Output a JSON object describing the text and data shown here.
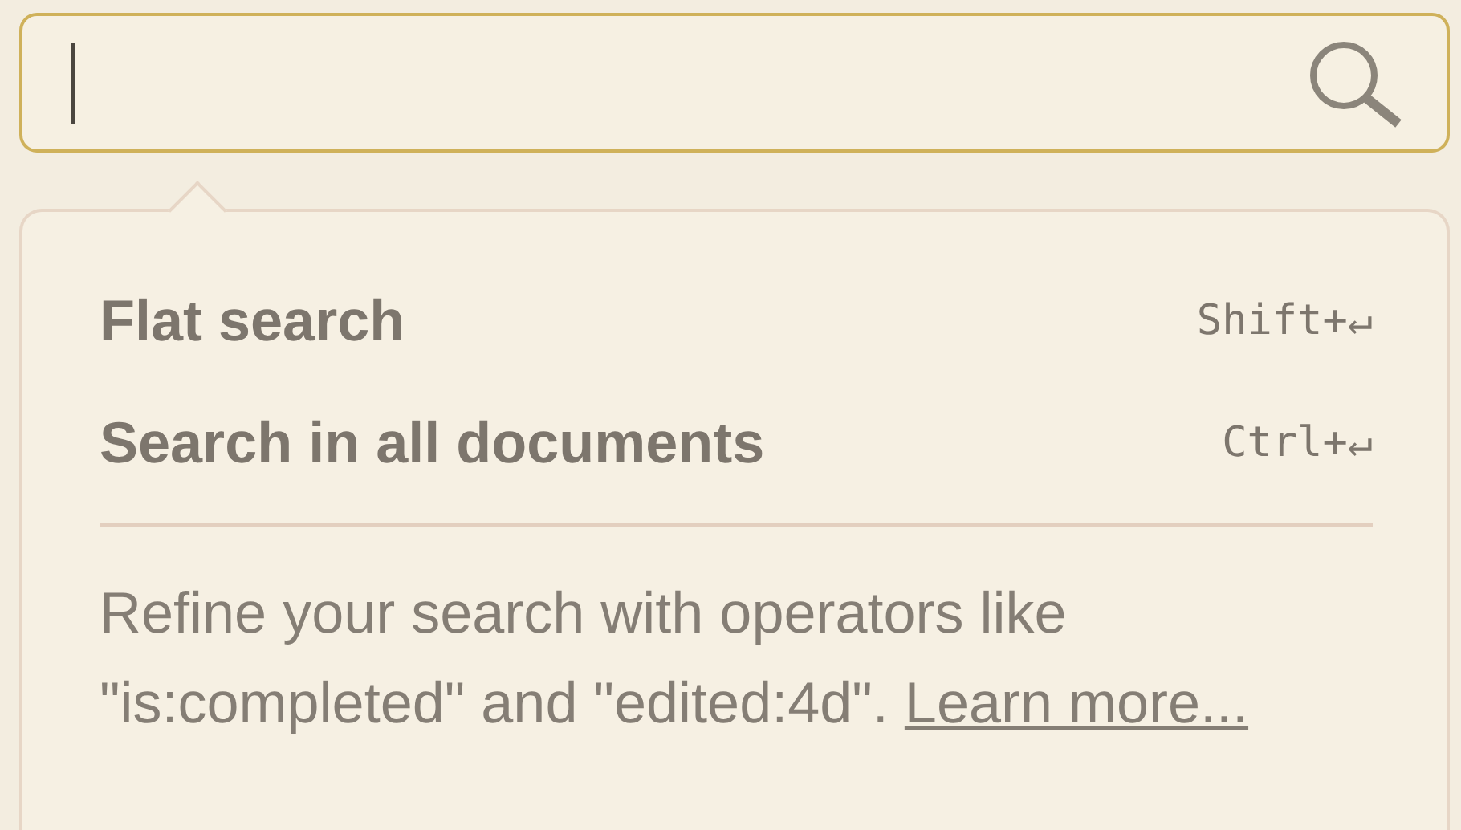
{
  "search_field": {
    "focused": true
  },
  "popup": {
    "options": [
      {
        "label": "Flat search",
        "shortcut": "Shift+↵"
      },
      {
        "label": "Search in all documents",
        "shortcut": "Ctrl+↵"
      }
    ],
    "help": {
      "text": "Refine your search with operators like \"is:completed\" and \"edited:4d\".",
      "link": "Learn more..."
    }
  }
}
